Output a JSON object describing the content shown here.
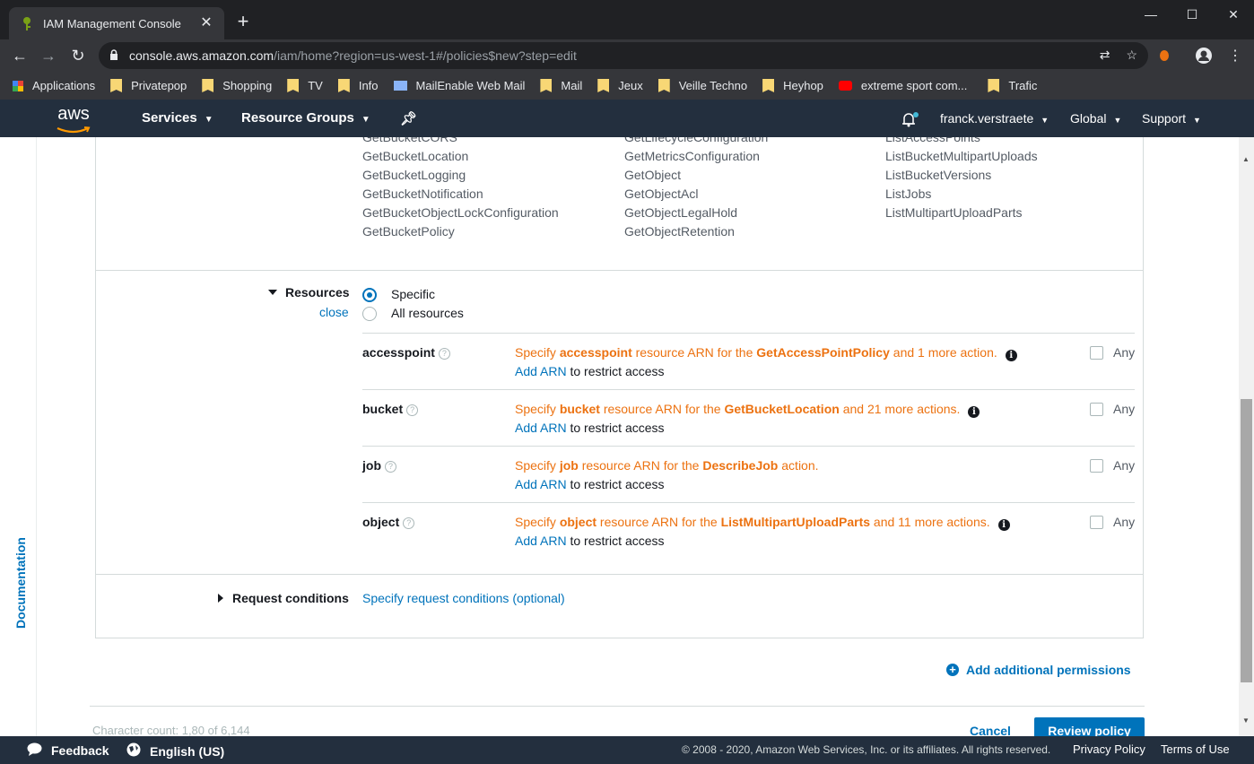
{
  "browser": {
    "tab_title": "IAM Management Console",
    "tab_close": "✕",
    "new_tab": "+",
    "url_host": "console.aws.amazon.com",
    "url_path": "/iam/home?region=us-west-1#/policies$new?step=edit",
    "window_controls": {
      "minimize": "—",
      "maximize": "☐",
      "close": "✕"
    },
    "bookmarks": [
      "Applications",
      "Privatepop",
      "Shopping",
      "TV",
      "Info",
      "MailEnable Web Mail",
      "Mail",
      "Jeux",
      "Veille Techno",
      "Heyhop",
      "extreme sport com...",
      "Trafic"
    ]
  },
  "awsnav": {
    "logo": "aws",
    "services": "Services",
    "resource_groups": "Resource Groups",
    "user": "franck.verstraete",
    "region": "Global",
    "support": "Support"
  },
  "sidebar": {
    "documentation": "Documentation"
  },
  "actions": {
    "col1": [
      "GetBucketCORS",
      "GetBucketLocation",
      "GetBucketLogging",
      "GetBucketNotification",
      "GetBucketObjectLockConfiguration",
      "GetBucketPolicy"
    ],
    "col2": [
      "GetLifecycleConfiguration",
      "GetMetricsConfiguration",
      "GetObject",
      "GetObjectAcl",
      "GetObjectLegalHold",
      "GetObjectRetention"
    ],
    "col3": [
      "ListAccessPoints",
      "ListBucketMultipartUploads",
      "ListBucketVersions",
      "ListJobs",
      "ListMultipartUploadParts"
    ]
  },
  "resources": {
    "label": "Resources",
    "close": "close",
    "specific": "Specific",
    "all": "All resources",
    "specific_selected": true,
    "rows": [
      {
        "name": "accesspoint",
        "pre": "Specify ",
        "type": "accesspoint",
        "mid": " resource ARN for the ",
        "action": "GetAccessPointPolicy",
        "post": " and 1 more action.",
        "has_info": true,
        "add": "Add ARN",
        "restrict": " to restrict access",
        "any": "Any"
      },
      {
        "name": "bucket",
        "pre": "Specify ",
        "type": "bucket",
        "mid": " resource ARN for the ",
        "action": "GetBucketLocation",
        "post": " and 21 more actions.",
        "has_info": true,
        "add": "Add ARN",
        "restrict": " to restrict access",
        "any": "Any"
      },
      {
        "name": "job",
        "pre": "Specify ",
        "type": "job",
        "mid": " resource ARN for the ",
        "action": "DescribeJob",
        "post": " action.",
        "has_info": false,
        "add": "Add ARN",
        "restrict": " to restrict access",
        "any": "Any"
      },
      {
        "name": "object",
        "pre": "Specify ",
        "type": "object",
        "mid": " resource ARN for the ",
        "action": "ListMultipartUploadParts",
        "post": " and 11 more actions.",
        "has_info": true,
        "add": "Add ARN",
        "restrict": " to restrict access",
        "any": "Any"
      }
    ]
  },
  "request_conditions": {
    "label": "Request conditions",
    "link": "Specify request conditions (optional)"
  },
  "add_permissions": "Add additional permissions",
  "bottom": {
    "chars": "Character count: 1,80 of 6,144",
    "cancel": "Cancel",
    "review": "Review policy"
  },
  "footer": {
    "feedback": "Feedback",
    "language": "English (US)",
    "copyright": "© 2008 - 2020, Amazon Web Services, Inc. or its affiliates. All rights reserved.",
    "privacy": "Privacy Policy",
    "terms": "Terms of Use"
  },
  "colors": {
    "aws_nav": "#232f3e",
    "link": "#0073bb",
    "warning": "#ec7211"
  }
}
